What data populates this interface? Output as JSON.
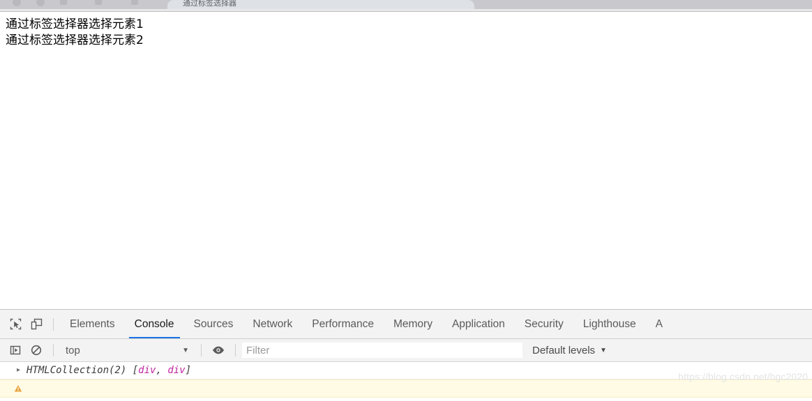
{
  "browser": {
    "tab_title": "通过标签选择器",
    "tab_icon": "page-icon"
  },
  "page": {
    "lines": [
      "通过标签选择器选择元素1",
      "通过标签选择器选择元素2"
    ]
  },
  "devtools": {
    "inspect_icon": "inspect-element-icon",
    "device_icon": "device-toolbar-icon",
    "tabs": [
      {
        "label": "Elements",
        "active": false
      },
      {
        "label": "Console",
        "active": true
      },
      {
        "label": "Sources",
        "active": false
      },
      {
        "label": "Network",
        "active": false
      },
      {
        "label": "Performance",
        "active": false
      },
      {
        "label": "Memory",
        "active": false
      },
      {
        "label": "Application",
        "active": false
      },
      {
        "label": "Security",
        "active": false
      },
      {
        "label": "Lighthouse",
        "active": false
      },
      {
        "label": "A",
        "active": false
      }
    ],
    "active_tab_underline_color": "#1a73e8",
    "console_toolbar": {
      "sidebar_icon": "console-sidebar-icon",
      "clear_icon": "clear-console-icon",
      "context_value": "top",
      "context_arrow": "▼",
      "eye_icon": "live-expression-eye-icon",
      "filter_placeholder": "Filter",
      "filter_value": "",
      "levels_label": "Default levels",
      "levels_arrow": "▼"
    },
    "messages": [
      {
        "arrow": "▸",
        "prefix": "HTMLCollection(2) ",
        "bracket_open": "[",
        "tag1": "div",
        "comma": ", ",
        "tag2": "div",
        "bracket_close": "]"
      }
    ],
    "warning_row": {
      "icon": "warning-triangle-icon",
      "text": ""
    }
  },
  "watermark": {
    "text": "https://blog.csdn.net/hgc2020"
  },
  "colors": {
    "accent": "#1a73e8",
    "tag_magenta": "#c026a0",
    "warning_bg": "#fffbe5",
    "chrome_bg": "#c9c9cd",
    "devtools_bg": "#f3f3f3"
  }
}
